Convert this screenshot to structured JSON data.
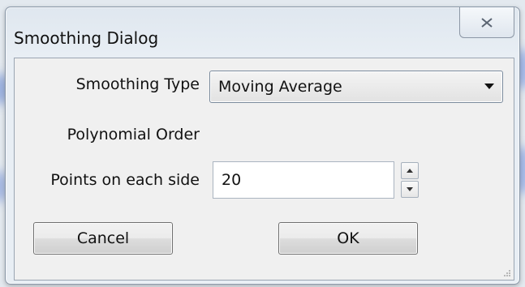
{
  "window": {
    "title": "Smoothing Dialog",
    "close_icon": "close-icon"
  },
  "form": {
    "smoothing_type_label": "Smoothing Type",
    "smoothing_type_value": "Moving Average",
    "polynomial_order_label": "Polynomial Order",
    "points_label": "Points on each side",
    "points_value": "20"
  },
  "buttons": {
    "cancel_label": "Cancel",
    "ok_label": "OK"
  },
  "colors": {
    "window_frame": "#dfe7ef",
    "client_bg": "#f0f0f0"
  }
}
